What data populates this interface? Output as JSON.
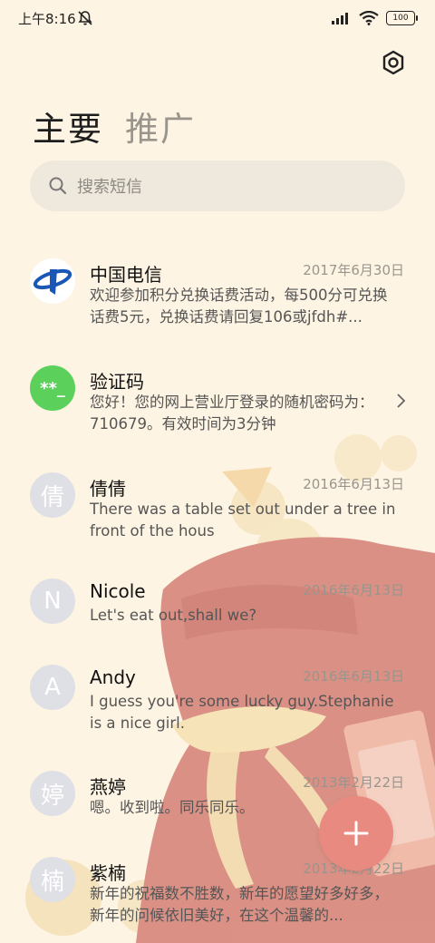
{
  "status_bar": {
    "time": "上午8:16",
    "battery": "100"
  },
  "header": {
    "tabs": [
      {
        "label": "主要",
        "active": true
      },
      {
        "label": "推广",
        "active": false
      }
    ]
  },
  "search": {
    "placeholder": "搜索短信"
  },
  "messages": [
    {
      "name": "中国电信",
      "date": "2017年6月30日",
      "preview": "欢迎参加积分兑换话费活动，每500分可兑换话费5元，兑换话费请回复106或jfdh#...",
      "avatar_type": "china-telecom-logo",
      "avatar_letter": ""
    },
    {
      "name": "验证码",
      "date": "",
      "preview": "您好！您的网上营业厅登录的随机密码为：710679。有效时间为3分钟",
      "avatar_type": "verification-code",
      "avatar_letter": "**_"
    },
    {
      "name": "倩倩",
      "date": "2016年6月13日",
      "preview": "There was a table set out under a tree in front of the hous",
      "avatar_type": "letter",
      "avatar_letter": "倩"
    },
    {
      "name": "Nicole",
      "date": "2016年6月13日",
      "preview": "Let's eat out,shall we?",
      "avatar_type": "letter",
      "avatar_letter": "N"
    },
    {
      "name": "Andy",
      "date": "2016年6月13日",
      "preview": "I guess you're some lucky guy.Stephanie is a nice girl.",
      "avatar_type": "letter",
      "avatar_letter": "A"
    },
    {
      "name": "燕婷",
      "date": "2013年2月22日",
      "preview": "嗯。收到啦。同乐同乐。",
      "avatar_type": "letter",
      "avatar_letter": "婷"
    },
    {
      "name": "紫楠",
      "date": "2013年2月22日",
      "preview": "新年的祝福数不胜数，新年的愿望好多好多，新年的问候依旧美好，在这个温馨的...",
      "avatar_type": "letter",
      "avatar_letter": "楠"
    }
  ],
  "colors": {
    "background": "#fdf4e3",
    "fab": "#e98a80",
    "verification_avatar": "#5bd15b",
    "telecom_blue": "#1a56b5"
  }
}
